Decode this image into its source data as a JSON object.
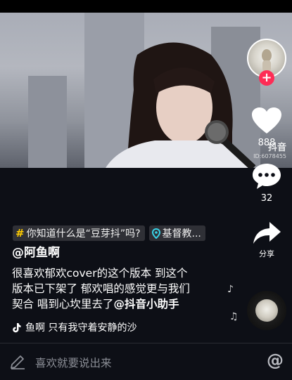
{
  "video": {
    "watermark_logo": "抖音",
    "watermark_id": "ID:6078455"
  },
  "sidebar": {
    "like_count": "888",
    "comment_count": "32",
    "share_label": "分享"
  },
  "tags": {
    "challenge": "你知道什么是“豆芽抖”吗?",
    "location": "基督教..."
  },
  "post": {
    "username": "@阿鱼啊",
    "caption_line1": "很喜欢郁欢cover的这个版本 到这个",
    "caption_line2": "版本已下架了 郁欢唱的感觉更与我们",
    "caption_line3": "契合 唱到心坎里去了",
    "caption_mention": "@抖音小助手"
  },
  "music": {
    "text": "鱼啊    只有我守着安静的沙"
  },
  "comment_bar": {
    "placeholder": "喜欢就要说出来"
  },
  "colors": {
    "background": "#0d0f16",
    "follow_accent": "#fe2c55",
    "hashtag_accent": "#ffcc00",
    "location_pin": "#38d4e8"
  }
}
